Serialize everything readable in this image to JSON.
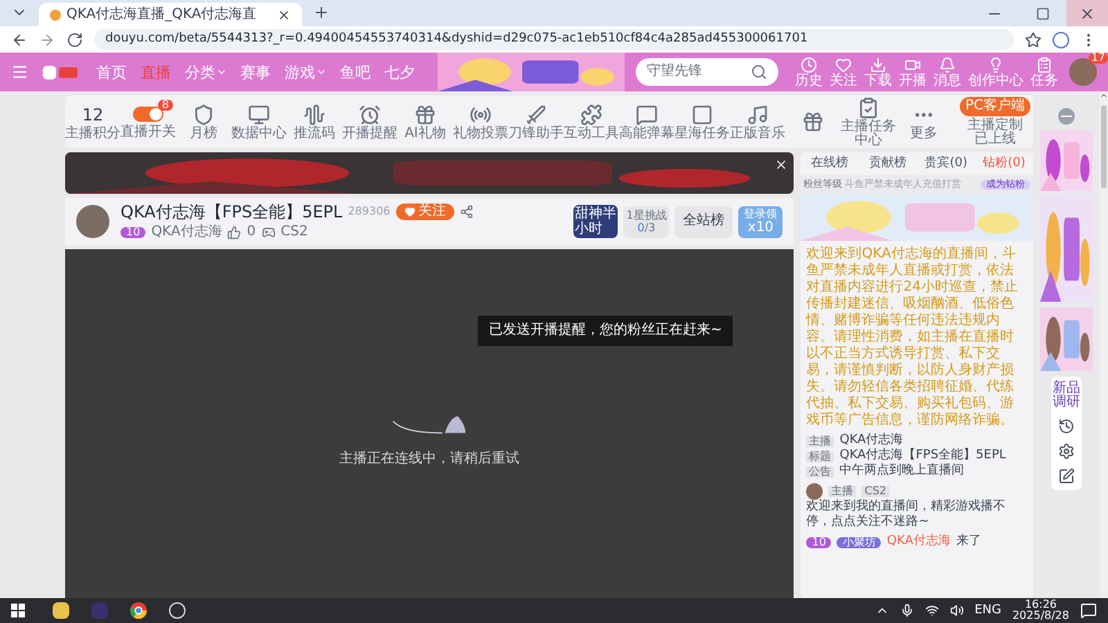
{
  "browser": {
    "tab_title": "QKA付志海直播_QKA付志海直",
    "url": "douyu.com/beta/5544313?_r=0.49400454553740314&dyshid=d29c075-ac1eb510cf84c4a285ad455300061701"
  },
  "nav": {
    "items": [
      {
        "label": "首页",
        "selected": false,
        "dropdown": false
      },
      {
        "label": "直播",
        "selected": true,
        "dropdown": false
      },
      {
        "label": "分类",
        "selected": false,
        "dropdown": true
      },
      {
        "label": "赛事",
        "selected": false,
        "dropdown": false
      },
      {
        "label": "游戏",
        "selected": false,
        "dropdown": true
      },
      {
        "label": "鱼吧",
        "selected": false,
        "dropdown": false
      },
      {
        "label": "七夕",
        "selected": false,
        "dropdown": false
      }
    ],
    "search": {
      "placeholder": "守望先锋"
    },
    "actions": [
      "历史",
      "关注",
      "下载",
      "开播",
      "消息",
      "创作中心",
      "任务"
    ],
    "avatar_badge": "17"
  },
  "toolbar": {
    "items": [
      {
        "kind": "score",
        "value": "12",
        "label": "主播积分"
      },
      {
        "kind": "toggle",
        "on": true,
        "badge": "8",
        "label": "直播开关"
      },
      {
        "kind": "icon",
        "label": "月榜"
      },
      {
        "kind": "icon",
        "label": "数据中心"
      },
      {
        "kind": "icon",
        "label": "推流码"
      },
      {
        "kind": "icon",
        "label": "开播提醒"
      },
      {
        "kind": "icon",
        "label": "AI礼物"
      },
      {
        "kind": "icon",
        "label": "礼物投票"
      },
      {
        "kind": "icon",
        "label": "刀锋助手"
      },
      {
        "kind": "icon",
        "label": "互动工具"
      },
      {
        "kind": "icon",
        "label": "高能弹幕"
      },
      {
        "kind": "icon",
        "label": "星海任务"
      },
      {
        "kind": "icon",
        "label": "正版音乐"
      },
      {
        "kind": "icon"
      },
      {
        "kind": "icon",
        "label": "主播任务中心"
      },
      {
        "kind": "icon",
        "label": "更多"
      }
    ],
    "client_button": "PC客户端",
    "client_note": "主播定制已上线"
  },
  "room": {
    "title": "QKA付志海【FPS全能】5EPL",
    "room_id": "289306",
    "follow": "关注",
    "level_badge": "10",
    "streamer": "QKA付志海",
    "likes": "0",
    "game": "CS2",
    "promo": "甜神半小时",
    "challenge": {
      "title": "1星挑战",
      "done": "0",
      "total": "/3"
    },
    "rank": "全站榜",
    "login": {
      "label": "登录领",
      "count": "x10"
    }
  },
  "video": {
    "toast": "已发送开播提醒，您的粉丝正在赶来~",
    "status": "主播正在连线中，请稍后重试"
  },
  "side": {
    "tabs": [
      {
        "label": "在线榜",
        "selected": false
      },
      {
        "label": "贡献榜",
        "selected": false
      },
      {
        "label": "贵宾(0)",
        "selected": false
      },
      {
        "label": "钻粉(0)",
        "selected": true
      }
    ],
    "fan_level": "粉丝等级",
    "fan_notice": "斗鱼严禁未成年人充值打赏",
    "become_fan": "成为钻粉",
    "notice": "欢迎来到QKA付志海的直播间，斗鱼严禁未成年人直播或打赏，依法对直播内容进行24小时巡查，禁止传播封建迷信、吸烟酗酒、低俗色情、赌博诈骗等任何违法违规内容。请理性消费，如主播在直播时以不正当方式诱导打赏、私下交易，请谨慎判断，以防人身财产损失。请勿轻信各类招聘征婚、代练代抽、私下交易、购买礼包码、游戏币等广告信息，谨防网络诈骗。",
    "info": [
      {
        "tag": "主播",
        "text": "QKA付志海"
      },
      {
        "tag": "标题",
        "text": "QKA付志海【FPS全能】5EPL"
      },
      {
        "tag": "公告",
        "text": "中午两点到晚上直播间"
      }
    ],
    "chat": {
      "role": "主播",
      "game": "CS2",
      "message": "欢迎来到我的直播间，精彩游戏播不停，点点关注不迷路~"
    },
    "welcome": {
      "level": "10",
      "badge": "小聚坊",
      "user": "QKA付志海",
      "text": "来了"
    }
  },
  "strip": {
    "survey": "新品调研"
  },
  "taskbar": {
    "lang": "ENG",
    "time": "16:26",
    "date": "2025/8/28"
  }
}
